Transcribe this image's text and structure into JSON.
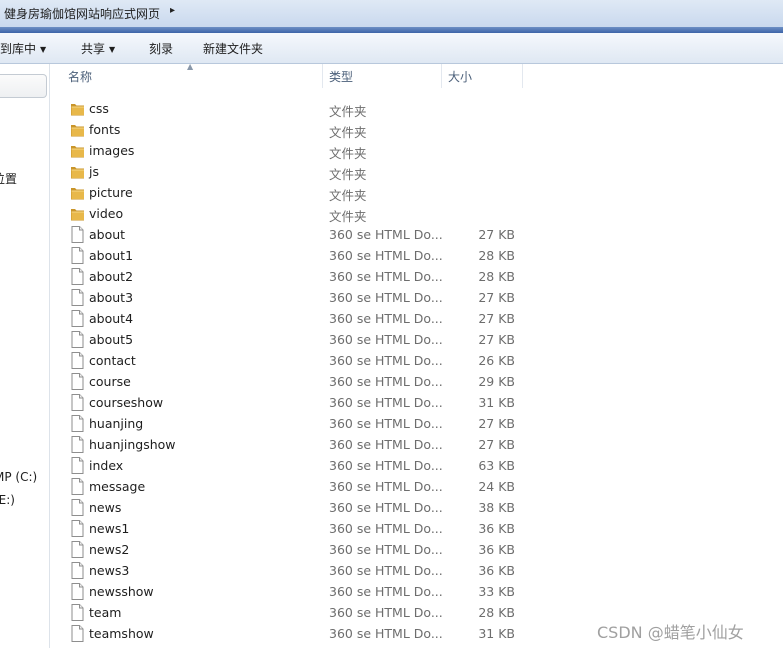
{
  "address": {
    "path": "健身房瑜伽馆网站响应式网页",
    "arrow_icon": "chevron-right-icon"
  },
  "toolbar": {
    "library_label": "到库中",
    "share_label": "共享",
    "burn_label": "刻录",
    "new_folder_label": "新建文件夹"
  },
  "nav": {
    "items": [
      {
        "label": "位置"
      },
      {
        "label": "MP (C:)"
      },
      {
        "label": "(E:)"
      }
    ]
  },
  "columns": {
    "name": "名称",
    "type": "类型",
    "size": "大小"
  },
  "files": [
    {
      "name": "css",
      "type": "文件夹",
      "size": "",
      "kind": "folder"
    },
    {
      "name": "fonts",
      "type": "文件夹",
      "size": "",
      "kind": "folder"
    },
    {
      "name": "images",
      "type": "文件夹",
      "size": "",
      "kind": "folder"
    },
    {
      "name": "js",
      "type": "文件夹",
      "size": "",
      "kind": "folder"
    },
    {
      "name": "picture",
      "type": "文件夹",
      "size": "",
      "kind": "folder"
    },
    {
      "name": "video",
      "type": "文件夹",
      "size": "",
      "kind": "folder"
    },
    {
      "name": "about",
      "type": "360 se HTML Do...",
      "size": "27 KB",
      "kind": "file"
    },
    {
      "name": "about1",
      "type": "360 se HTML Do...",
      "size": "28 KB",
      "kind": "file"
    },
    {
      "name": "about2",
      "type": "360 se HTML Do...",
      "size": "28 KB",
      "kind": "file"
    },
    {
      "name": "about3",
      "type": "360 se HTML Do...",
      "size": "27 KB",
      "kind": "file"
    },
    {
      "name": "about4",
      "type": "360 se HTML Do...",
      "size": "27 KB",
      "kind": "file"
    },
    {
      "name": "about5",
      "type": "360 se HTML Do...",
      "size": "27 KB",
      "kind": "file"
    },
    {
      "name": "contact",
      "type": "360 se HTML Do...",
      "size": "26 KB",
      "kind": "file"
    },
    {
      "name": "course",
      "type": "360 se HTML Do...",
      "size": "29 KB",
      "kind": "file"
    },
    {
      "name": "courseshow",
      "type": "360 se HTML Do...",
      "size": "31 KB",
      "kind": "file"
    },
    {
      "name": "huanjing",
      "type": "360 se HTML Do...",
      "size": "27 KB",
      "kind": "file"
    },
    {
      "name": "huanjingshow",
      "type": "360 se HTML Do...",
      "size": "27 KB",
      "kind": "file"
    },
    {
      "name": "index",
      "type": "360 se HTML Do...",
      "size": "63 KB",
      "kind": "file"
    },
    {
      "name": "message",
      "type": "360 se HTML Do...",
      "size": "24 KB",
      "kind": "file"
    },
    {
      "name": "news",
      "type": "360 se HTML Do...",
      "size": "38 KB",
      "kind": "file"
    },
    {
      "name": "news1",
      "type": "360 se HTML Do...",
      "size": "36 KB",
      "kind": "file"
    },
    {
      "name": "news2",
      "type": "360 se HTML Do...",
      "size": "36 KB",
      "kind": "file"
    },
    {
      "name": "news3",
      "type": "360 se HTML Do...",
      "size": "36 KB",
      "kind": "file"
    },
    {
      "name": "newsshow",
      "type": "360 se HTML Do...",
      "size": "33 KB",
      "kind": "file"
    },
    {
      "name": "team",
      "type": "360 se HTML Do...",
      "size": "28 KB",
      "kind": "file"
    },
    {
      "name": "teamshow",
      "type": "360 se HTML Do...",
      "size": "31 KB",
      "kind": "file"
    }
  ],
  "watermark": "CSDN @蜡笔小仙女",
  "colors": {
    "folder": "#e8b84a",
    "folder_dark": "#c9952a",
    "blue_strip": "#3d64a8"
  }
}
